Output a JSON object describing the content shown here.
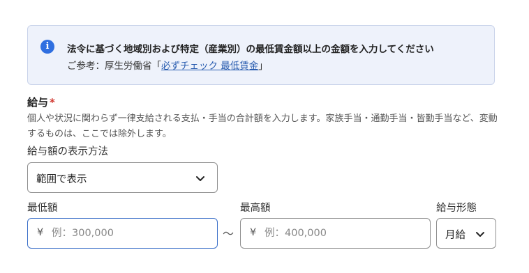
{
  "notice": {
    "icon": "info-icon",
    "main_text": "法令に基づく地域別および特定（産業別）の最低賃金額以上の金額を入力してください",
    "sub_prefix": "ご参考：厚生労働省「",
    "link_text": "必ずチェック 最低賃金",
    "sub_suffix": "」"
  },
  "salary": {
    "title": "給与",
    "required_mark": "*",
    "description": "個人や状況に関わらず一律支給される支払・手当の合計額を入力します。家族手当・通勤手当・皆勤手当など、変動するものは、ここでは除外します。",
    "display_method_label": "給与額の表示方法",
    "display_method_value": "範囲で表示",
    "min_label": "最低額",
    "min_currency": "¥",
    "min_placeholder": "例：300,000",
    "range_separator": "〜",
    "max_label": "最高額",
    "max_currency": "¥",
    "max_placeholder": "例：400,000",
    "type_label": "給与形態",
    "type_value": "月給"
  },
  "colors": {
    "notice_bg": "#eef2fb",
    "info_icon": "#2f6fe0",
    "link": "#2a5db0",
    "required": "#d0342c",
    "focused_border": "#3c70c9"
  }
}
